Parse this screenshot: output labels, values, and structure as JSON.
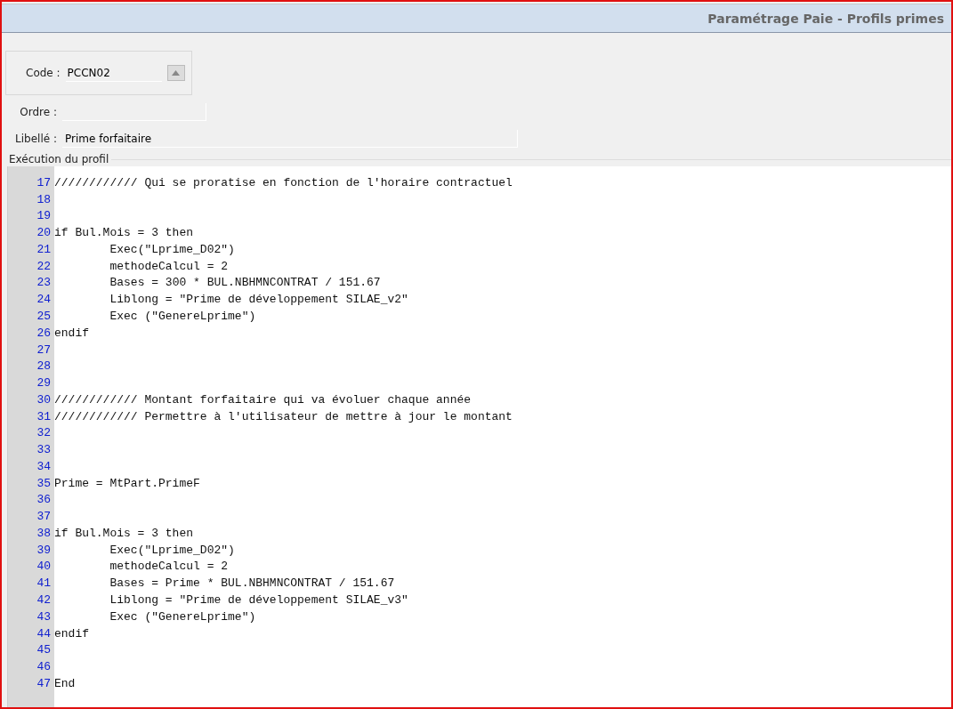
{
  "window": {
    "title": "Paramétrage Paie - Profils primes"
  },
  "code_field": {
    "label": "Code :",
    "value": "PCCN02"
  },
  "order_field": {
    "label": "Ordre :"
  },
  "label_field": {
    "label": "Libellé :",
    "value": "Prime forfaitaire"
  },
  "profile_execution": {
    "legend": "Exécution du profil",
    "lines": [
      {
        "number": "17",
        "text": "//////////// Qui se proratise en fonction de l'horaire contractuel"
      },
      {
        "number": "18"
      },
      {
        "number": "19"
      },
      {
        "number": "20",
        "text": "if Bul.Mois = 3 then"
      },
      {
        "number": "21",
        "text": "\tExec(\"Lprime_D02\")"
      },
      {
        "number": "22",
        "text": "\tmethodeCalcul = 2"
      },
      {
        "number": "23",
        "text": "\tBases = 300 * BUL.NBHMNCONTRAT / 151.67"
      },
      {
        "number": "24",
        "text": "\tLiblong = \"Prime de développement SILAE_v2\""
      },
      {
        "number": "25",
        "text": "\tExec (\"GenereLprime\")"
      },
      {
        "number": "26",
        "text": "endif"
      },
      {
        "number": "27"
      },
      {
        "number": "28"
      },
      {
        "number": "29"
      },
      {
        "number": "30",
        "text": "//////////// Montant forfaitaire qui va évoluer chaque année"
      },
      {
        "number": "31",
        "text": "//////////// Permettre à l'utilisateur de mettre à jour le montant"
      },
      {
        "number": "32"
      },
      {
        "number": "33"
      },
      {
        "number": "34"
      },
      {
        "number": "35",
        "text": "Prime = MtPart.PrimeF"
      },
      {
        "number": "36"
      },
      {
        "number": "37"
      },
      {
        "number": "38",
        "text": "if Bul.Mois = 3 then"
      },
      {
        "number": "39",
        "text": "\tExec(\"Lprime_D02\")"
      },
      {
        "number": "40",
        "text": "\tmethodeCalcul = 2"
      },
      {
        "number": "41",
        "text": "\tBases = Prime * BUL.NBHMNCONTRAT / 151.67"
      },
      {
        "number": "42",
        "text": "\tLiblong = \"Prime de développement SILAE_v3\""
      },
      {
        "number": "43",
        "text": "\tExec (\"GenereLprime\")"
      },
      {
        "number": "44",
        "text": "endif"
      },
      {
        "number": "45"
      },
      {
        "number": "46"
      },
      {
        "number": "47",
        "text": "End"
      }
    ]
  }
}
